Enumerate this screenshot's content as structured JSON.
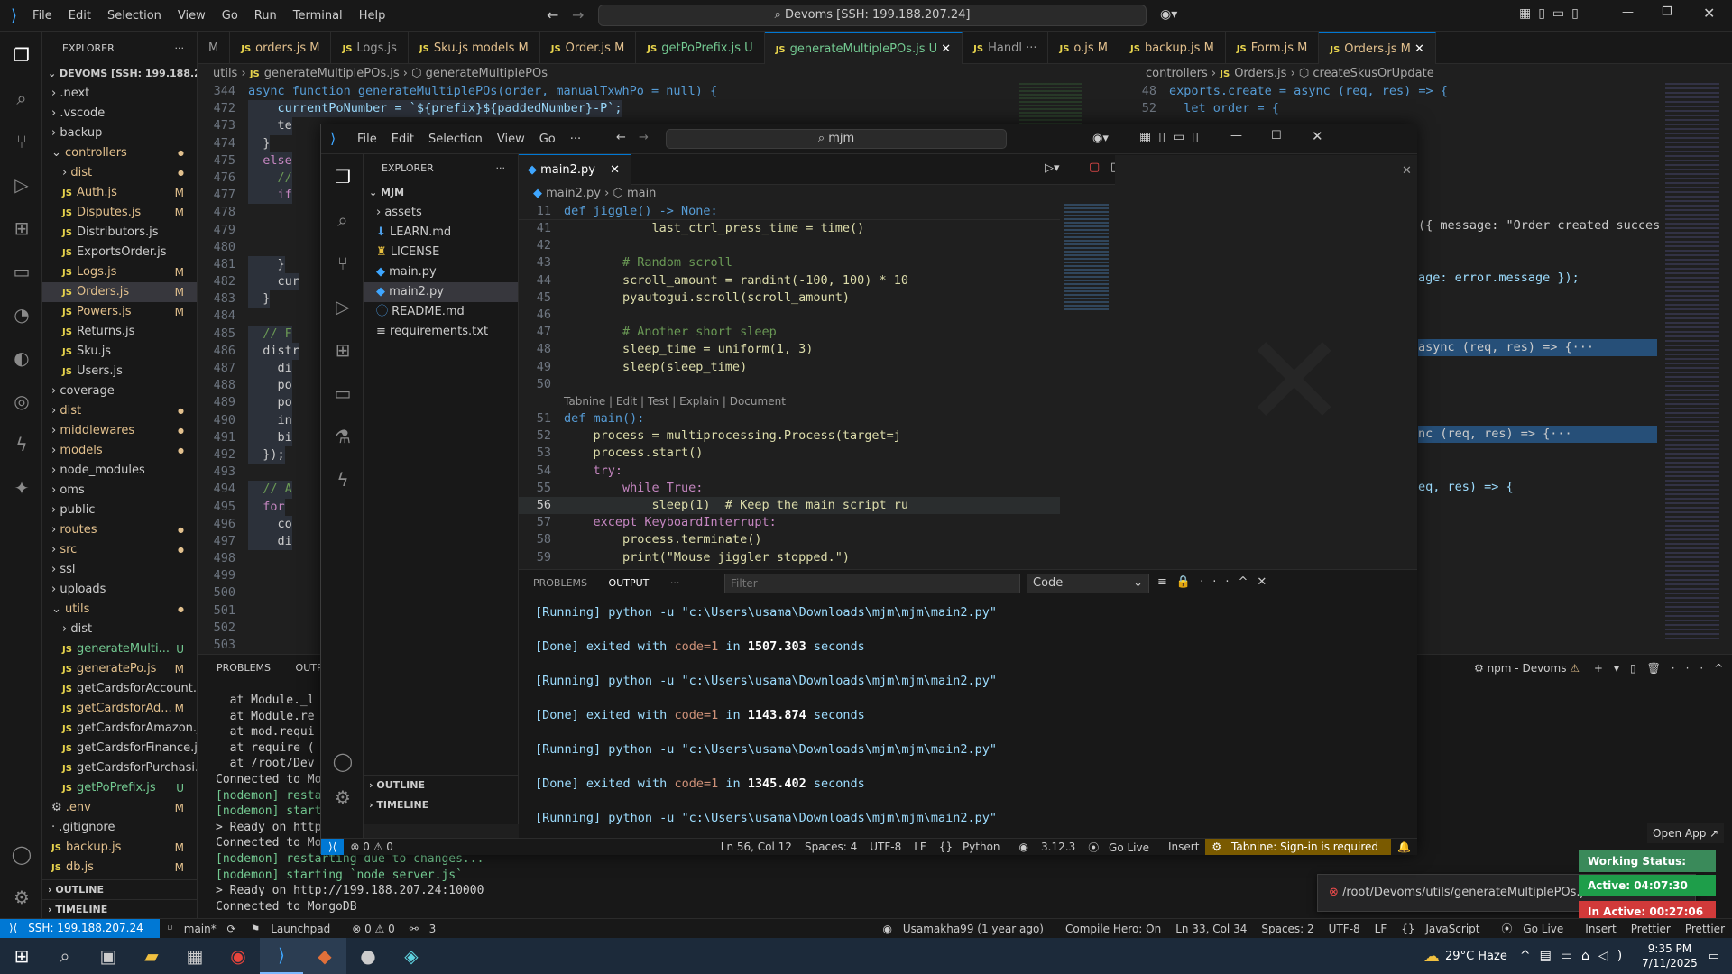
{
  "back": {
    "menu": [
      "File",
      "Edit",
      "Selection",
      "View",
      "Go",
      "Run",
      "Terminal",
      "Help"
    ],
    "command_center": "Devoms [SSH: 199.188.207.24]",
    "explorer_title": "EXPLORER",
    "workspace": "DEVOMS [SSH: 199.188.20...",
    "tree": [
      {
        "label": ".next",
        "kind": "folder",
        "depth": 1,
        "badge": ""
      },
      {
        "label": ".vscode",
        "kind": "folder",
        "depth": 1,
        "badge": ""
      },
      {
        "label": "backup",
        "kind": "folder",
        "depth": 1,
        "badge": ""
      },
      {
        "label": "controllers",
        "kind": "folder-open",
        "depth": 1,
        "badge": "●"
      },
      {
        "label": "dist",
        "kind": "folder",
        "depth": 2,
        "badge": "●"
      },
      {
        "label": "Auth.js",
        "kind": "js",
        "depth": 2,
        "badge": "M"
      },
      {
        "label": "Disputes.js",
        "kind": "js",
        "depth": 2,
        "badge": "M"
      },
      {
        "label": "Distributors.js",
        "kind": "js",
        "depth": 2,
        "badge": ""
      },
      {
        "label": "ExportsOrder.js",
        "kind": "js",
        "depth": 2,
        "badge": ""
      },
      {
        "label": "Logs.js",
        "kind": "js",
        "depth": 2,
        "badge": "M"
      },
      {
        "label": "Orders.js",
        "kind": "js",
        "depth": 2,
        "badge": "M",
        "selected": true
      },
      {
        "label": "Powers.js",
        "kind": "js",
        "depth": 2,
        "badge": "M"
      },
      {
        "label": "Returns.js",
        "kind": "js",
        "depth": 2,
        "badge": ""
      },
      {
        "label": "Sku.js",
        "kind": "js",
        "depth": 2,
        "badge": ""
      },
      {
        "label": "Users.js",
        "kind": "js",
        "depth": 2,
        "badge": ""
      },
      {
        "label": "coverage",
        "kind": "folder",
        "depth": 1,
        "badge": ""
      },
      {
        "label": "dist",
        "kind": "folder",
        "depth": 1,
        "badge": "●"
      },
      {
        "label": "middlewares",
        "kind": "folder",
        "depth": 1,
        "badge": "●"
      },
      {
        "label": "models",
        "kind": "folder",
        "depth": 1,
        "badge": "●"
      },
      {
        "label": "node_modules",
        "kind": "folder",
        "depth": 1,
        "badge": ""
      },
      {
        "label": "oms",
        "kind": "folder",
        "depth": 1,
        "badge": ""
      },
      {
        "label": "public",
        "kind": "folder",
        "depth": 1,
        "badge": ""
      },
      {
        "label": "routes",
        "kind": "folder",
        "depth": 1,
        "badge": "●"
      },
      {
        "label": "src",
        "kind": "folder",
        "depth": 1,
        "badge": "●"
      },
      {
        "label": "ssl",
        "kind": "folder",
        "depth": 1,
        "badge": ""
      },
      {
        "label": "uploads",
        "kind": "folder",
        "depth": 1,
        "badge": ""
      },
      {
        "label": "utils",
        "kind": "folder-open",
        "depth": 1,
        "badge": "●"
      },
      {
        "label": "dist",
        "kind": "folder",
        "depth": 2,
        "badge": ""
      },
      {
        "label": "generateMulti...",
        "kind": "js",
        "depth": 2,
        "badge": "U"
      },
      {
        "label": "generatePo.js",
        "kind": "js",
        "depth": 2,
        "badge": "M"
      },
      {
        "label": "getCardsforAccount.js",
        "kind": "js",
        "depth": 2,
        "badge": ""
      },
      {
        "label": "getCardsforAd...",
        "kind": "js",
        "depth": 2,
        "badge": "M"
      },
      {
        "label": "getCardsforAmazon.js",
        "kind": "js",
        "depth": 2,
        "badge": ""
      },
      {
        "label": "getCardsforFinance.js",
        "kind": "js",
        "depth": 2,
        "badge": ""
      },
      {
        "label": "getCardsforPurchasi...",
        "kind": "js",
        "depth": 2,
        "badge": ""
      },
      {
        "label": "getPoPrefix.js",
        "kind": "js",
        "depth": 2,
        "badge": "U"
      },
      {
        "label": ".env",
        "kind": "env",
        "depth": 1,
        "badge": "M"
      },
      {
        "label": ".gitignore",
        "kind": "file",
        "depth": 1,
        "badge": ""
      },
      {
        "label": "backup.js",
        "kind": "js",
        "depth": 1,
        "badge": "M"
      },
      {
        "label": "db.js",
        "kind": "js",
        "depth": 1,
        "badge": "M"
      }
    ],
    "outline_label": "OUTLINE",
    "timeline_label": "TIMELINE",
    "tabs": [
      {
        "label": "M",
        "active": false
      },
      {
        "label": "orders.js M",
        "active": false
      },
      {
        "label": "Logs.js",
        "active": false
      },
      {
        "label": "Sku.js models M",
        "active": false
      },
      {
        "label": "Order.js M",
        "active": false
      },
      {
        "label": "getPoPrefix.js U",
        "active": false
      },
      {
        "label": "generateMultiplePOs.js U",
        "active": true
      },
      {
        "label": "Handl ···",
        "active": false
      },
      {
        "label": "o.js M",
        "active": false
      },
      {
        "label": "backup.js M",
        "active": false
      },
      {
        "label": "Form.js M",
        "active": false
      },
      {
        "label": "Orders.js M",
        "active": true
      }
    ],
    "breadcrumb_left": [
      "utils",
      "generateMultiplePOs.js",
      "generateMultiplePOs"
    ],
    "breadcrumb_right": [
      "controllers",
      "Orders.js",
      "createSkusOrUpdate"
    ],
    "left_code": [
      {
        "n": "344",
        "t": "async function generateMultiplePOs(order, manualTxwhPo = null) {"
      },
      {
        "n": "472",
        "t": "    currentPoNumber = `${prefix}${paddedNumber}-P`;"
      },
      {
        "n": "473",
        "t": "    te"
      },
      {
        "n": "474",
        "t": "  }"
      },
      {
        "n": "475",
        "t": "  else"
      },
      {
        "n": "476",
        "t": "    //"
      },
      {
        "n": "477",
        "t": "    if"
      },
      {
        "n": "478",
        "t": ""
      },
      {
        "n": "479",
        "t": ""
      },
      {
        "n": "480",
        "t": ""
      },
      {
        "n": "481",
        "t": "    }"
      },
      {
        "n": "482",
        "t": "    cur"
      },
      {
        "n": "483",
        "t": "  }"
      },
      {
        "n": "484",
        "t": ""
      },
      {
        "n": "485",
        "t": "  // F"
      },
      {
        "n": "486",
        "t": "  distr"
      },
      {
        "n": "487",
        "t": "    di"
      },
      {
        "n": "488",
        "t": "    po"
      },
      {
        "n": "489",
        "t": "    po"
      },
      {
        "n": "490",
        "t": "    in"
      },
      {
        "n": "491",
        "t": "    bi"
      },
      {
        "n": "492",
        "t": "  });"
      },
      {
        "n": "493",
        "t": ""
      },
      {
        "n": "494",
        "t": "  // A"
      },
      {
        "n": "495",
        "t": "  for"
      },
      {
        "n": "496",
        "t": "    co"
      },
      {
        "n": "497",
        "t": "    di"
      },
      {
        "n": "498",
        "t": ""
      },
      {
        "n": "499",
        "t": ""
      },
      {
        "n": "500",
        "t": ""
      },
      {
        "n": "501",
        "t": ""
      },
      {
        "n": "502",
        "t": ""
      },
      {
        "n": "503",
        "t": ""
      }
    ],
    "right_code": [
      {
        "n": "48",
        "t": "exports.create = async (req, res) => {"
      },
      {
        "n": "52",
        "t": "  let order = {"
      }
    ],
    "right_fragments": [
      "({ message: \"Order created succes",
      "age: error.message });",
      "async (req, res) => {···",
      "nc (req, res) => {···",
      "eq, res) => {"
    ],
    "terminal_tabs": [
      "PROBLEMS",
      "OUTPU"
    ],
    "terminal_lines": [
      "  at Module._l",
      "  at Module.re",
      "  at mod.requi",
      "  at require (",
      "  at /root/Dev",
      "Connected to Mong",
      "[nodemon] restar",
      "[nodemon] starti",
      "> Ready on http:",
      "Connected to Mong",
      "[nodemon] restarting due to changes...",
      "[nodemon] starting `node server.js`",
      "> Ready on http://199.188.207.24:10000",
      "Connected to MongoDB"
    ],
    "terminal_label": "npm - Devoms",
    "notification_path": "/root/Devoms/utils/generateMultiplePOs.js:",
    "open_app": "Open App ↗",
    "working_status": "Working Status: Active",
    "active_time": "Active: 04:07:30",
    "inactive_time": "In Active: 00:27:06",
    "status": {
      "remote": "SSH: 199.188.207.24",
      "branch": "main*",
      "launchpad": "Launchpad",
      "problems": "⊗ 0 ⚠ 0",
      "ports": "3",
      "blame": "Usamakha99 (1 year ago)",
      "compile": "Compile Hero: On",
      "position": "Ln 33, Col 34",
      "spaces": "Spaces: 2",
      "encoding": "UTF-8",
      "eol": "LF",
      "language": "JavaScript",
      "golive": "Go Live",
      "insert": "Insert",
      "prettier": "Prettier",
      "prettier2": "Prettier"
    }
  },
  "front": {
    "menu": [
      "File",
      "Edit",
      "Selection",
      "View",
      "Go",
      "···"
    ],
    "search": "mjm",
    "explorer_title": "EXPLORER",
    "folder": "MJM",
    "files": [
      {
        "label": "assets",
        "kind": "folder"
      },
      {
        "label": "LEARN.md",
        "kind": "md"
      },
      {
        "label": "LICENSE",
        "kind": "license"
      },
      {
        "label": "main.py",
        "kind": "py"
      },
      {
        "label": "main2.py",
        "kind": "py",
        "selected": true
      },
      {
        "label": "README.md",
        "kind": "info"
      },
      {
        "label": "requirements.txt",
        "kind": "txt"
      }
    ],
    "outline": "OUTLINE",
    "timeline": "TIMELINE",
    "tab": "main2.py",
    "breadcrumb": [
      "main2.py",
      "main"
    ],
    "sticky": {
      "n": "11",
      "t": "def jiggle() -> None:"
    },
    "code": [
      {
        "n": "41",
        "t": "            last_ctrl_press_time = time()"
      },
      {
        "n": "42",
        "t": ""
      },
      {
        "n": "43",
        "t": "        # Random scroll"
      },
      {
        "n": "44",
        "t": "        scroll_amount = randint(-100, 100) * 10"
      },
      {
        "n": "45",
        "t": "        pyautogui.scroll(scroll_amount)"
      },
      {
        "n": "46",
        "t": ""
      },
      {
        "n": "47",
        "t": "        # Another short sleep"
      },
      {
        "n": "48",
        "t": "        sleep_time = uniform(1, 3)"
      },
      {
        "n": "49",
        "t": "        sleep(sleep_time)"
      },
      {
        "n": "50",
        "t": ""
      },
      {
        "n": "",
        "t": "Tabnine | Edit | Test | Explain | Document"
      },
      {
        "n": "51",
        "t": "def main():"
      },
      {
        "n": "52",
        "t": "    process = multiprocessing.Process(target=j"
      },
      {
        "n": "53",
        "t": "    process.start()"
      },
      {
        "n": "54",
        "t": "    try:"
      },
      {
        "n": "55",
        "t": "        while True:"
      },
      {
        "n": "56",
        "t": "            sleep(1)  # Keep the main script ru"
      },
      {
        "n": "57",
        "t": "    except KeyboardInterrupt:"
      },
      {
        "n": "58",
        "t": "        process.terminate()"
      },
      {
        "n": "59",
        "t": "        print(\"Mouse jiggler stopped.\")"
      }
    ],
    "panel_tabs": [
      "PROBLEMS",
      "OUTPUT",
      "···"
    ],
    "filter_placeholder": "Filter",
    "channel": "Code",
    "output": [
      {
        "kind": "run",
        "text": "[Running] python -u \"c:\\Users\\usama\\Downloads\\mjm\\mjm\\main2.py\""
      },
      {
        "kind": "done",
        "prefix": "[Done] exited with ",
        "code": "code=1",
        "mid": " in ",
        "secs": "1507.303",
        "suffix": " seconds"
      },
      {
        "kind": "run",
        "text": "[Running] python -u \"c:\\Users\\usama\\Downloads\\mjm\\mjm\\main2.py\""
      },
      {
        "kind": "done",
        "prefix": "[Done] exited with ",
        "code": "code=1",
        "mid": " in ",
        "secs": "1143.874",
        "suffix": " seconds"
      },
      {
        "kind": "run",
        "text": "[Running] python -u \"c:\\Users\\usama\\Downloads\\mjm\\mjm\\main2.py\""
      },
      {
        "kind": "done",
        "prefix": "[Done] exited with ",
        "code": "code=1",
        "mid": " in ",
        "secs": "1345.402",
        "suffix": " seconds"
      },
      {
        "kind": "run",
        "text": "[Running] python -u \"c:\\Users\\usama\\Downloads\\mjm\\mjm\\main2.py\""
      }
    ],
    "status": {
      "problems": "⊗ 0 ⚠ 0",
      "position": "Ln 56, Col 12",
      "spaces": "Spaces: 4",
      "encoding": "UTF-8",
      "eol": "LF",
      "language": "Python",
      "version": "3.12.3",
      "golive": "Go Live",
      "insert": "Insert",
      "tabnine": "Tabnine: Sign-in is required"
    }
  },
  "taskbar": {
    "weather": "29°C Haze",
    "time": "9:35 PM",
    "date": "7/11/2025"
  },
  "colors": {
    "accent": "#0078d4",
    "keyword": "#569cd6",
    "control": "#c586c0",
    "function": "#dcdcaa",
    "string": "#ce9178",
    "comment": "#6a9955",
    "number": "#b5cea8",
    "variable": "#9cdcfe",
    "type": "#4ec9b0",
    "modified": "#e2c08d",
    "untracked": "#73c991"
  }
}
